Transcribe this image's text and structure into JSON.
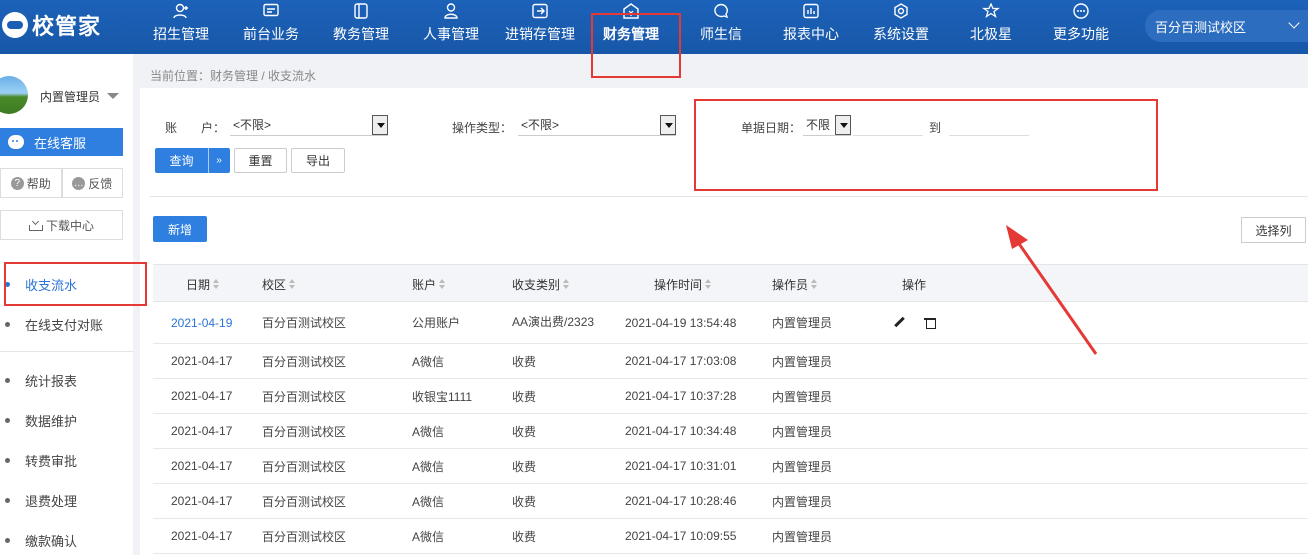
{
  "app": {
    "logo": "校管家"
  },
  "nav": [
    {
      "label": "招生管理",
      "icon": "user-plus-icon"
    },
    {
      "label": "前台业务",
      "icon": "monitor-icon"
    },
    {
      "label": "教务管理",
      "icon": "book-icon"
    },
    {
      "label": "人事管理",
      "icon": "person-icon"
    },
    {
      "label": "进销存管理",
      "icon": "inventory-icon"
    },
    {
      "label": "财务管理",
      "icon": "finance-icon"
    },
    {
      "label": "师生信",
      "icon": "chat-icon"
    },
    {
      "label": "报表中心",
      "icon": "report-icon"
    },
    {
      "label": "系统设置",
      "icon": "gear-icon"
    },
    {
      "label": "北极星",
      "icon": "star-icon"
    },
    {
      "label": "更多功能",
      "icon": "more-icon"
    }
  ],
  "campus": "百分百测试校区",
  "user": {
    "name": "内置管理员"
  },
  "sidebar": {
    "service": "在线客服",
    "help": "帮助",
    "feedback": "反馈",
    "download": "下载中心",
    "items": [
      "收支流水",
      "在线支付对账",
      "统计报表",
      "数据维护",
      "转费审批",
      "退费处理",
      "缴款确认"
    ]
  },
  "breadcrumb": "当前位置：财务管理 / 收支流水",
  "filters": {
    "account_label": "账　　户：",
    "account_value": "<不限>",
    "optype_label": "操作类型：",
    "optype_value": "<不限>",
    "date_label": "单据日期：",
    "date_value": "不限",
    "to_label": "到"
  },
  "buttons": {
    "query": "查询",
    "reset": "重置",
    "export": "导出",
    "add": "新增",
    "columns": "选择列"
  },
  "table": {
    "headers": [
      "日期",
      "校区",
      "账户",
      "收支类别",
      "操作时间",
      "操作员",
      "操作"
    ],
    "rows": [
      [
        "2021-04-19",
        "百分百测试校区",
        "公用账户",
        "AA演出费/2323",
        "2021-04-19 13:54:48",
        "内置管理员"
      ],
      [
        "2021-04-17",
        "百分百测试校区",
        "A微信",
        "收费",
        "2021-04-17 17:03:08",
        "内置管理员"
      ],
      [
        "2021-04-17",
        "百分百测试校区",
        "收银宝1111",
        "收费",
        "2021-04-17 10:37:28",
        "内置管理员"
      ],
      [
        "2021-04-17",
        "百分百测试校区",
        "A微信",
        "收费",
        "2021-04-17 10:34:48",
        "内置管理员"
      ],
      [
        "2021-04-17",
        "百分百测试校区",
        "A微信",
        "收费",
        "2021-04-17 10:31:01",
        "内置管理员"
      ],
      [
        "2021-04-17",
        "百分百测试校区",
        "A微信",
        "收费",
        "2021-04-17 10:28:46",
        "内置管理员"
      ],
      [
        "2021-04-17",
        "百分百测试校区",
        "A微信",
        "收费",
        "2021-04-17 10:09:55",
        "内置管理员"
      ]
    ]
  },
  "colors": {
    "header_blue": "#1a5fb4",
    "accent": "#2f7fe0",
    "annotation_red": "#e53935"
  }
}
